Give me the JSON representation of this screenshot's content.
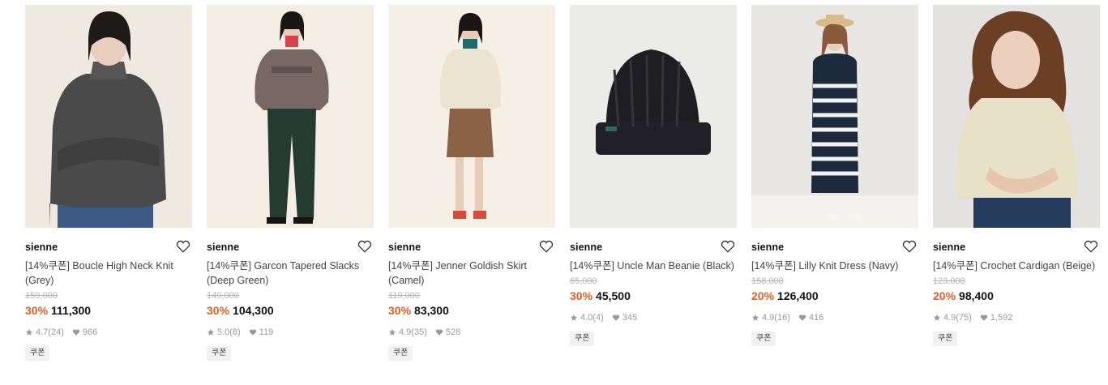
{
  "products": [
    {
      "brand": "sienne",
      "title": "[14%쿠폰] Boucle High Neck Knit (Grey)",
      "orig_price": "159,000",
      "discount": "30%",
      "price": "111,300",
      "rating": "4.7",
      "reviews": "(24)",
      "likes": "966",
      "coupon": "쿠폰"
    },
    {
      "brand": "sienne",
      "title": "[14%쿠폰] Garcon Tapered Slacks (Deep Green)",
      "orig_price": "149,000",
      "discount": "30%",
      "price": "104,300",
      "rating": "5.0",
      "reviews": "(8)",
      "likes": "119",
      "coupon": "쿠폰"
    },
    {
      "brand": "sienne",
      "title": "[14%쿠폰] Jenner Goldish Skirt (Camel)",
      "orig_price": "119,000",
      "discount": "30%",
      "price": "83,300",
      "rating": "4.9",
      "reviews": "(35)",
      "likes": "528",
      "coupon": "쿠폰"
    },
    {
      "brand": "sienne",
      "title": "[14%쿠폰] Uncle Man Beanie (Black)",
      "orig_price": "65,000",
      "discount": "30%",
      "price": "45,500",
      "rating": "4.0",
      "reviews": "(4)",
      "likes": "345",
      "coupon": "쿠폰"
    },
    {
      "brand": "sienne",
      "title": "[14%쿠폰] Lilly Knit Dress (Navy)",
      "orig_price": "158,000",
      "discount": "20%",
      "price": "126,400",
      "rating": "4.9",
      "reviews": "(16)",
      "likes": "416",
      "coupon": "쿠폰"
    },
    {
      "brand": "sienne",
      "title": "[14%쿠폰] Crochet Cardigan (Beige)",
      "orig_price": "123,000",
      "discount": "20%",
      "price": "98,400",
      "rating": "4.9",
      "reviews": "(75)",
      "likes": "1,592",
      "coupon": "쿠폰"
    }
  ],
  "icons": {
    "wishlist": "heart-outline-icon",
    "rating": "star-icon",
    "likes": "heart-filled-icon"
  },
  "colors": {
    "discount": "#ef5a1f",
    "original_price": "#b5b5b5",
    "meta": "#9a9a9a",
    "coupon_bg": "#f1f1f1"
  }
}
